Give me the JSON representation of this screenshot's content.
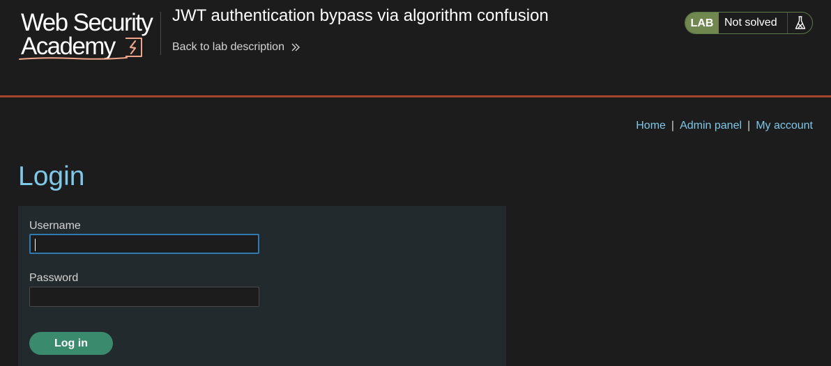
{
  "logo": {
    "line1": "Web Security",
    "line2": "Academy",
    "mark_icon": "lightning-icon"
  },
  "header": {
    "lab_title": "JWT authentication bypass via algorithm confusion",
    "back_link": "Back to lab description",
    "lab_badge": "LAB",
    "lab_status": "Not solved",
    "lab_status_icon": "flask-icon"
  },
  "nav": {
    "items": [
      "Home",
      "Admin panel",
      "My account"
    ],
    "separator": "|"
  },
  "page": {
    "title": "Login"
  },
  "form": {
    "username_label": "Username",
    "username_value": "",
    "password_label": "Password",
    "password_value": "",
    "submit_label": "Log in"
  },
  "colors": {
    "background": "#1c1c1c",
    "header_border": "#a5462d",
    "link": "#7ec8e8",
    "lab_badge": "#70884f",
    "button": "#3a8a6e",
    "panel": "#222a2d",
    "focus_border": "#2f7ab0"
  }
}
